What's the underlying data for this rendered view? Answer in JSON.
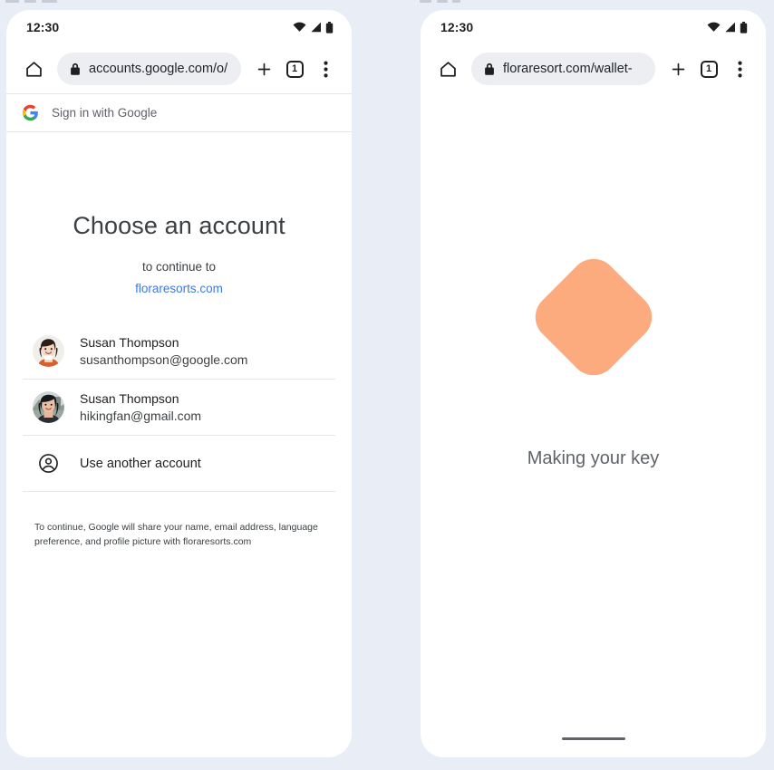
{
  "page": {
    "background_color": "#e9edf6"
  },
  "phones": {
    "left": {
      "status_bar": {
        "time": "12:30",
        "icons": [
          "wifi-icon",
          "signal-icon",
          "battery-icon"
        ]
      },
      "browser": {
        "home_icon": "home-icon",
        "lock_icon": "lock-icon",
        "url": "accounts.google.com/o/",
        "new_tab_icon": "plus-icon",
        "tab_count": "1",
        "menu_icon": "overflow-menu-icon"
      },
      "google_header": {
        "logo": "google-g-icon",
        "label": "Sign in with Google"
      },
      "chooser": {
        "title": "Choose an account",
        "subtitle": "to continue to",
        "domain": "floraresorts.com",
        "accounts": [
          {
            "avatar": "avatar-photo-susan-google",
            "name": "Susan Thompson",
            "email": "susanthompson@google.com"
          },
          {
            "avatar": "avatar-photo-susan-gmail",
            "name": "Susan Thompson",
            "email": "hikingfan@gmail.com"
          }
        ],
        "use_another_account": {
          "icon": "account-circle-icon",
          "label": "Use another account"
        },
        "disclaimer": "To continue, Google will share your name, email address, language preference, and profile picture with floraresorts.com"
      }
    },
    "right": {
      "status_bar": {
        "time": "12:30",
        "icons": [
          "wifi-icon",
          "signal-icon",
          "battery-icon"
        ]
      },
      "browser": {
        "home_icon": "home-icon",
        "lock_icon": "lock-icon",
        "url": "floraresort.com/wallet-",
        "new_tab_icon": "plus-icon",
        "tab_count": "1",
        "menu_icon": "overflow-menu-icon"
      },
      "wallet": {
        "shape_icon": "rounded-diamond-key-shape",
        "shape_color": "#fbab7d",
        "caption": "Making your key",
        "home_indicator": "home-indicator"
      }
    }
  },
  "colors": {
    "link_blue": "#3b79e8",
    "accent_peach": "#fbab7d",
    "omnibox_grey": "#eceef1",
    "text_primary": "#202124",
    "text_secondary": "#5f6368"
  }
}
